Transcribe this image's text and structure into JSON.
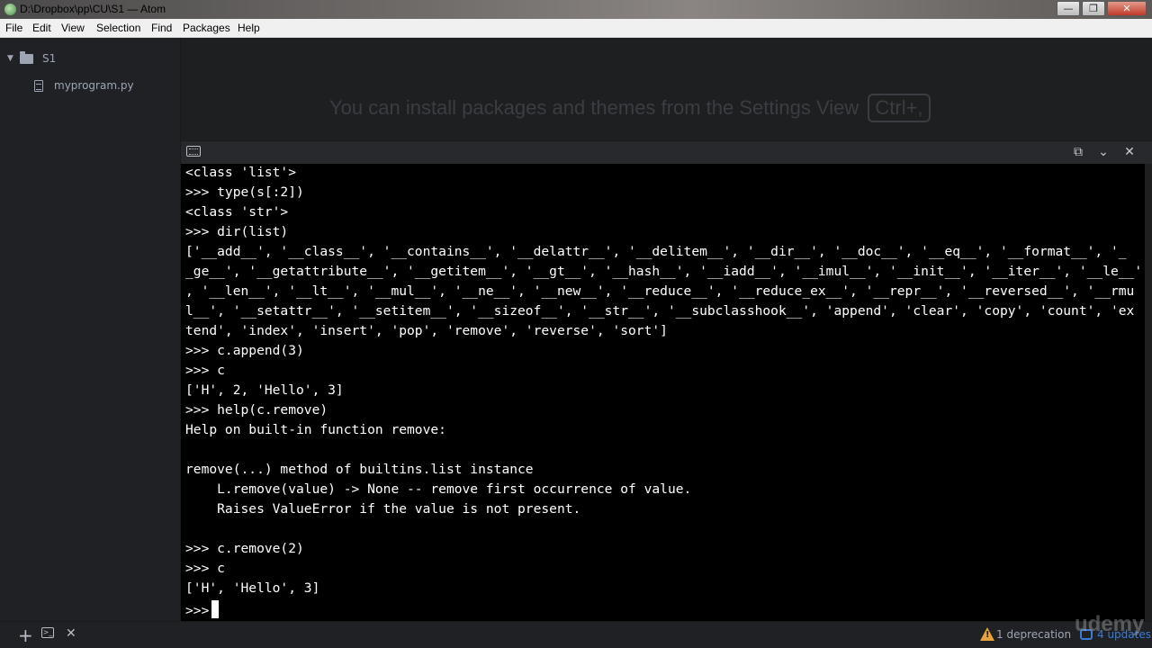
{
  "window": {
    "title": "D:\\Dropbox\\pp\\CU\\S1 — Atom",
    "minimize": "—",
    "maximize": "❐",
    "close": "✕"
  },
  "menu": [
    "File",
    "Edit",
    "View",
    "Selection",
    "Find",
    "Packages",
    "Help"
  ],
  "tree": {
    "root": "S1",
    "files": [
      "myprogram.py"
    ]
  },
  "editor": {
    "hint": "You can install packages and themes from the Settings View",
    "shortcut": "Ctrl+,"
  },
  "terminal": {
    "lines": [
      "<class 'list'>",
      ">>> type(s[:2])",
      "<class 'str'>",
      ">>> dir(list)",
      "['__add__', '__class__', '__contains__', '__delattr__', '__delitem__', '__dir__', '__doc__', '__eq__', '__format__', '_",
      "_ge__', '__getattribute__', '__getitem__', '__gt__', '__hash__', '__iadd__', '__imul__', '__init__', '__iter__', '__le__'",
      ", '__len__', '__lt__', '__mul__', '__ne__', '__new__', '__reduce__', '__reduce_ex__', '__repr__', '__reversed__', '__rmu",
      "l__', '__setattr__', '__setitem__', '__sizeof__', '__str__', '__subclasshook__', 'append', 'clear', 'copy', 'count', 'ex",
      "tend', 'index', 'insert', 'pop', 'remove', 'reverse', 'sort']",
      ">>> c.append(3)",
      ">>> c",
      "['H', 2, 'Hello', 3]",
      ">>> help(c.remove)",
      "Help on built-in function remove:",
      "",
      "remove(...) method of builtins.list instance",
      "    L.remove(value) -> None -- remove first occurrence of value.",
      "    Raises ValueError if the value is not present.",
      "",
      ">>> c.remove(2)",
      ">>> c",
      "['H', 'Hello', 3]",
      ">>>"
    ]
  },
  "status": {
    "deprecation": "1 deprecation",
    "updates": "4 updates",
    "add": "+",
    "close": "✕"
  },
  "watermark": "udemy",
  "icons": [
    "app-icon",
    "folder-icon",
    "file-icon",
    "keyboard-icon",
    "maximize-panel-icon",
    "chevron-down-icon",
    "close-icon",
    "add-icon",
    "terminal-icon",
    "warning-icon",
    "updates-icon"
  ]
}
